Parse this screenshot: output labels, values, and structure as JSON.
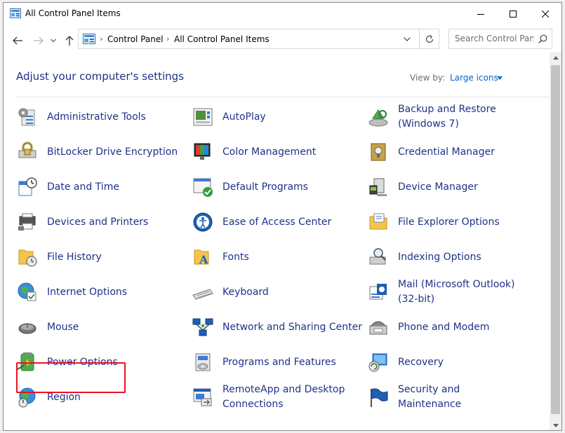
{
  "window": {
    "title": "All Control Panel Items"
  },
  "address_bar": {
    "crumbs": [
      "Control Panel",
      "All Control Panel Items"
    ]
  },
  "search": {
    "placeholder": "Search Control Panel"
  },
  "header": {
    "heading": "Adjust your computer's settings",
    "view_by_label": "View by:",
    "view_by_value": "Large icons"
  },
  "items": [
    {
      "label": "Administrative Tools",
      "icon": "administrative-tools-icon"
    },
    {
      "label": "AutoPlay",
      "icon": "autoplay-icon"
    },
    {
      "label": "Backup and Restore (Windows 7)",
      "icon": "backup-restore-icon"
    },
    {
      "label": "BitLocker Drive Encryption",
      "icon": "bitlocker-icon"
    },
    {
      "label": "Color Management",
      "icon": "color-management-icon"
    },
    {
      "label": "Credential Manager",
      "icon": "credential-manager-icon"
    },
    {
      "label": "Date and Time",
      "icon": "date-time-icon"
    },
    {
      "label": "Default Programs",
      "icon": "default-programs-icon"
    },
    {
      "label": "Device Manager",
      "icon": "device-manager-icon"
    },
    {
      "label": "Devices and Printers",
      "icon": "devices-printers-icon"
    },
    {
      "label": "Ease of Access Center",
      "icon": "ease-of-access-icon"
    },
    {
      "label": "File Explorer Options",
      "icon": "file-explorer-options-icon"
    },
    {
      "label": "File History",
      "icon": "file-history-icon"
    },
    {
      "label": "Fonts",
      "icon": "fonts-icon"
    },
    {
      "label": "Indexing Options",
      "icon": "indexing-options-icon"
    },
    {
      "label": "Internet Options",
      "icon": "internet-options-icon"
    },
    {
      "label": "Keyboard",
      "icon": "keyboard-icon"
    },
    {
      "label": "Mail (Microsoft Outlook) (32-bit)",
      "icon": "mail-icon"
    },
    {
      "label": "Mouse",
      "icon": "mouse-icon"
    },
    {
      "label": "Network and Sharing Center",
      "icon": "network-sharing-icon"
    },
    {
      "label": "Phone and Modem",
      "icon": "phone-modem-icon"
    },
    {
      "label": "Power Options",
      "icon": "power-options-icon"
    },
    {
      "label": "Programs and Features",
      "icon": "programs-features-icon"
    },
    {
      "label": "Recovery",
      "icon": "recovery-icon"
    },
    {
      "label": "Region",
      "icon": "region-icon"
    },
    {
      "label": "RemoteApp and Desktop Connections",
      "icon": "remoteapp-icon"
    },
    {
      "label": "Security and Maintenance",
      "icon": "security-maintenance-icon"
    }
  ],
  "colors": {
    "link": "#1e3287",
    "accent": "#0066cc",
    "highlight_border": "#e81123"
  }
}
